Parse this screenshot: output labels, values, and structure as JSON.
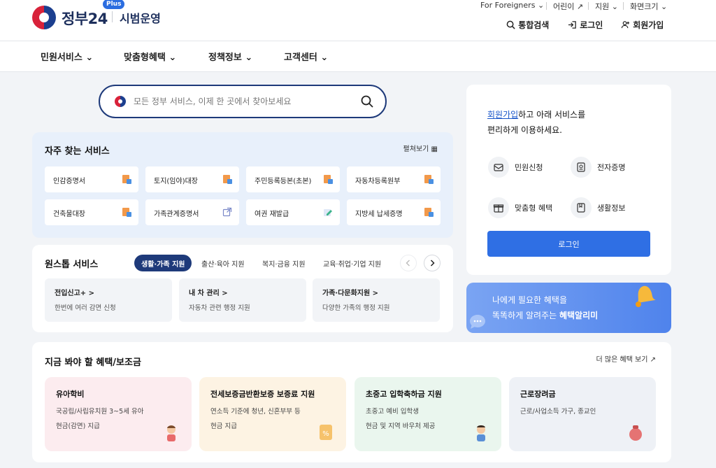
{
  "header": {
    "logo_text": "정부24",
    "plus_badge": "Plus",
    "logo_sub": "시범운영",
    "utility": [
      "For Foreigners",
      "어린이",
      "지원",
      "화면크기"
    ],
    "topnav": [
      "통합검색",
      "로그인",
      "회원가입"
    ]
  },
  "gnb": [
    "민원서비스",
    "맞춤형혜택",
    "정책정보",
    "고객센터"
  ],
  "search": {
    "placeholder": "모든 정부 서비스, 이제 한 곳에서 찾아보세요"
  },
  "frequent": {
    "title": "자주 찾는 서비스",
    "more": "펼쳐보기",
    "items": [
      "인감증명서",
      "토지(임야)대장",
      "주민등록등본(초본)",
      "자동차등록원부",
      "건축물대장",
      "가족관계증명서",
      "여권 재발급",
      "지방세 납세증명"
    ]
  },
  "onestop": {
    "title": "원스톱 서비스",
    "tabs": [
      "생활·가족 지원",
      "출산·육아 지원",
      "복지·금융 지원",
      "교육·취업·기업 지원"
    ],
    "cards": [
      {
        "title": "전입신고+ >",
        "desc": "한번에 여러 감면 신청"
      },
      {
        "title": "내 차 관리 >",
        "desc": "자동차 관련 행정 지원"
      },
      {
        "title": "가족·다문화지원 >",
        "desc": "다양한 가족의 행정 지원"
      }
    ]
  },
  "join": {
    "link": "회원가입",
    "line1_rest": "하고 아래 서비스를",
    "line2": "편리하게 이용하세요.",
    "items": [
      "민원신청",
      "전자증명",
      "맞춤형 혜택",
      "생활정보"
    ],
    "login_button": "로그인"
  },
  "alert": {
    "line1": "나에게 필요한 혜택을",
    "line2_prefix": "똑똑하게 알려주는 ",
    "line2_bold": "혜택알리미"
  },
  "benefits": {
    "title": "지금 봐야 할 혜택/보조금",
    "more": "더 많은 혜택 보기",
    "cards": [
      {
        "title": "유아학비",
        "l1": "국공립/사립유치원 3~5세 유아",
        "l2": "현금(감면) 지급",
        "bg": "#fcecef"
      },
      {
        "title": "전세보증금반환보증 보증료 지원",
        "l1": "연소득 기준에 청년, 신혼부부 등",
        "l2": "현금 지급",
        "bg": "#fdf3e3"
      },
      {
        "title": "초중고 입학축하금 지원",
        "l1": "초중고 예비 입학생",
        "l2": "현금 및 지역 바우처 제공",
        "bg": "#eaf6ee"
      },
      {
        "title": "근로장려금",
        "l1": "근로/사업소득 가구, 종교인",
        "l2": "",
        "bg": "#eef1f6"
      }
    ]
  },
  "colors": {
    "primary": "#2f6fe4",
    "navy": "#1e3a7a",
    "page_bg": "#f2f4f7"
  }
}
